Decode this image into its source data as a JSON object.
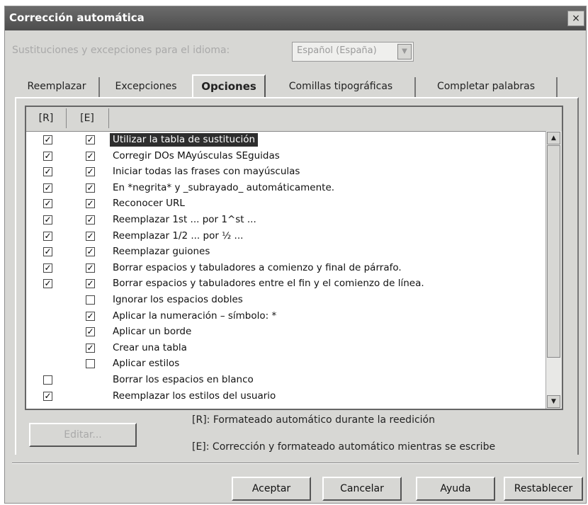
{
  "window": {
    "title": "Corrección automática",
    "close_glyph": "×"
  },
  "language": {
    "label": "Sustituciones y excepciones para el idioma:",
    "value": "Español (España)"
  },
  "tabs": [
    {
      "label": "Reemplazar",
      "active": false
    },
    {
      "label": "Excepciones",
      "active": false
    },
    {
      "label": "Opciones",
      "active": true
    },
    {
      "label": "Comillas tipográficas",
      "active": false
    },
    {
      "label": "Completar palabras",
      "active": false
    }
  ],
  "list": {
    "headers": {
      "r": "[R]",
      "e": "[E]"
    },
    "rows": [
      {
        "r": true,
        "e": true,
        "label": "Utilizar la tabla de sustitución",
        "selected": true
      },
      {
        "r": true,
        "e": true,
        "label": "Corregir DOs MAyúsculas SEguidas"
      },
      {
        "r": true,
        "e": true,
        "label": "Iniciar todas las frases con mayúsculas"
      },
      {
        "r": true,
        "e": true,
        "label": "En *negrita* y _subrayado_ automáticamente."
      },
      {
        "r": true,
        "e": true,
        "label": "Reconocer URL"
      },
      {
        "r": true,
        "e": true,
        "label": "Reemplazar 1st ... por 1^st ..."
      },
      {
        "r": true,
        "e": true,
        "label": "Reemplazar 1/2 ... por ½ ..."
      },
      {
        "r": true,
        "e": true,
        "label": "Reemplazar guiones"
      },
      {
        "r": true,
        "e": true,
        "label": "Borrar espacios y tabuladores a comienzo y final de párrafo."
      },
      {
        "r": true,
        "e": true,
        "label": "Borrar espacios y tabuladores entre el fin y el comienzo de línea."
      },
      {
        "r": null,
        "e": false,
        "label": "Ignorar los espacios dobles"
      },
      {
        "r": null,
        "e": true,
        "label": "Aplicar la numeración – símbolo: *"
      },
      {
        "r": null,
        "e": true,
        "label": "Aplicar un borde"
      },
      {
        "r": null,
        "e": true,
        "label": "Crear una tabla"
      },
      {
        "r": null,
        "e": false,
        "label": "Aplicar estilos"
      },
      {
        "r": false,
        "e": null,
        "label": "Borrar los espacios en blanco"
      },
      {
        "r": true,
        "e": null,
        "label": "Reemplazar los estilos del usuario"
      }
    ]
  },
  "edit_button": "Editar...",
  "legend": {
    "r": "[R]: Formateado automático durante la reedición",
    "e": "[E]: Corrección y formateado automático mientras se escribe"
  },
  "buttons": {
    "ok": "Aceptar",
    "cancel": "Cancelar",
    "help": "Ayuda",
    "reset": "Restablecer"
  },
  "check_glyph": "✓",
  "scroll": {
    "up_glyph": "▲",
    "down_glyph": "▼",
    "select_glyph": "▼"
  }
}
